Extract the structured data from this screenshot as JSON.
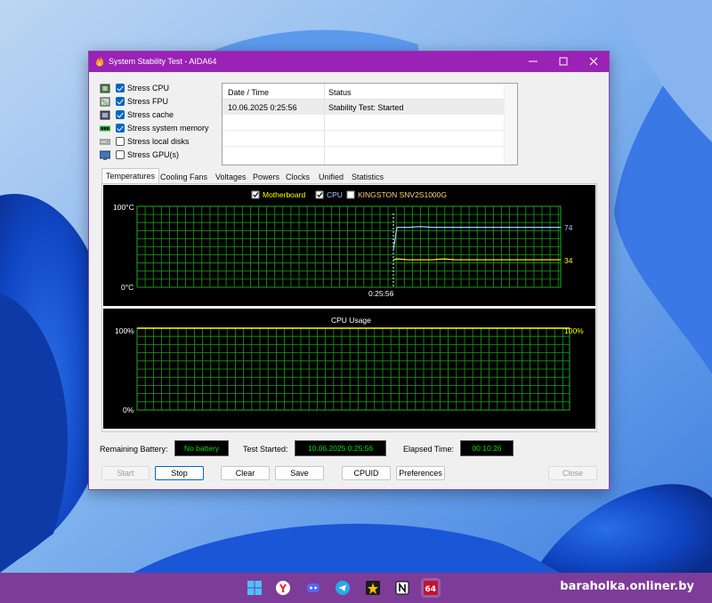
{
  "window": {
    "title": "System Stability Test - AIDA64",
    "controls": {
      "minimize": "minimize-icon",
      "maximize": "maximize-icon",
      "close": "close-icon"
    }
  },
  "options": [
    {
      "label": "Stress CPU",
      "checked": true,
      "icon": "cpu-icon"
    },
    {
      "label": "Stress FPU",
      "checked": true,
      "icon": "fpu-icon"
    },
    {
      "label": "Stress cache",
      "checked": true,
      "icon": "cache-icon"
    },
    {
      "label": "Stress system memory",
      "checked": true,
      "icon": "memory-icon"
    },
    {
      "label": "Stress local disks",
      "checked": false,
      "icon": "disk-icon"
    },
    {
      "label": "Stress GPU(s)",
      "checked": false,
      "icon": "gpu-icon"
    }
  ],
  "status_table": {
    "headers": {
      "date_time": "Date / Time",
      "status": "Status"
    },
    "rows": [
      {
        "date_time": "10.06.2025 0:25:56",
        "status": "Stability Test: Started"
      }
    ]
  },
  "tabs": [
    "Temperatures",
    "Cooling Fans",
    "Voltages",
    "Powers",
    "Clocks",
    "Unified",
    "Statistics"
  ],
  "active_tab": "Temperatures",
  "temperature_graph": {
    "legend": [
      {
        "label": "Motherboard",
        "checked": true,
        "color": "#ffff00"
      },
      {
        "label": "CPU",
        "checked": true,
        "color": "#aacbff"
      },
      {
        "label": "KINGSTON SNV2S1000G",
        "checked": false,
        "color": "#ffd27f"
      }
    ],
    "y_max_label": "100°C",
    "y_min_label": "0°C",
    "time_label": "0:25:56",
    "cpu_value_label": "74",
    "motherboard_value_label": "34"
  },
  "cpu_usage_graph": {
    "title": "CPU Usage",
    "y_max_label": "100%",
    "y_min_label": "0%",
    "current_label": "100%"
  },
  "chart_data": [
    {
      "type": "line",
      "title": "",
      "ylabel": "",
      "ylim": [
        0,
        100
      ],
      "series": [
        {
          "name": "CPU",
          "color": "#aacbff",
          "start_value": 46,
          "values": [
            74,
            74,
            75,
            74,
            74,
            74,
            74,
            74,
            74,
            74,
            74,
            74,
            74,
            74,
            74
          ]
        },
        {
          "name": "Motherboard",
          "color": "#ffff00",
          "start_value": 34,
          "values": [
            35,
            34,
            34,
            34,
            35,
            34,
            34,
            34,
            34,
            34,
            34,
            34,
            34,
            34,
            34
          ]
        }
      ],
      "event_time": "0:25:56"
    },
    {
      "type": "line",
      "title": "CPU Usage",
      "ylim": [
        0,
        100
      ],
      "series": [
        {
          "name": "CPU Usage",
          "color": "#ffff00",
          "values": [
            100
          ]
        }
      ]
    }
  ],
  "info": {
    "remaining_battery_label": "Remaining Battery:",
    "remaining_battery_value": "No battery",
    "test_started_label": "Test Started:",
    "test_started_value": "10.06.2025 0:25:56",
    "elapsed_time_label": "Elapsed Time:",
    "elapsed_time_value": "00:10:26"
  },
  "buttons": {
    "start": "Start",
    "stop": "Stop",
    "clear": "Clear",
    "save": "Save",
    "cpuid": "CPUID",
    "preferences": "Preferences",
    "close": "Close"
  },
  "taskbar": {
    "apps": [
      "windows-start-icon",
      "yandex-browser-icon",
      "discord-icon",
      "telegram-icon",
      "winamp-icon",
      "notion-icon",
      "aida64-icon"
    ],
    "watermark": "baraholka.onliner.by"
  }
}
